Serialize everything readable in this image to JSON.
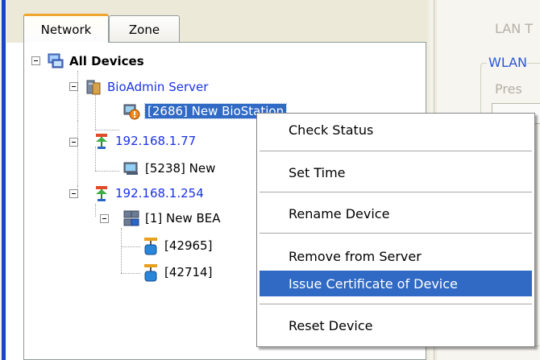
{
  "tabs": [
    {
      "label": "Network",
      "active": true
    },
    {
      "label": "Zone",
      "active": false
    }
  ],
  "tree": {
    "root": "All Devices",
    "server": "BioAdmin Server",
    "server_device": "[2686] New BioStation",
    "host1": "192.168.1.77",
    "host1_device": "[5238] New",
    "host2": "192.168.1.254",
    "host2_device": "[1] New BEA",
    "host2_child1": "[42965]",
    "host2_child2": "[42714]"
  },
  "context_menu": {
    "items": [
      {
        "label": "Check Status"
      },
      {
        "label": "Set Time"
      },
      {
        "label": "Rename Device"
      },
      {
        "label": "Remove from Server"
      },
      {
        "label": "Issue Certificate of Device",
        "highlighted": true
      },
      {
        "label": "Reset Device"
      }
    ]
  },
  "right_pane": {
    "lan_label": "LAN T",
    "wlan_label": "WLAN",
    "pres_label": "Pres"
  },
  "colors": {
    "selection": "#316ac5",
    "link_blue": "#1a32e6",
    "tab_accent": "#f0a431"
  }
}
